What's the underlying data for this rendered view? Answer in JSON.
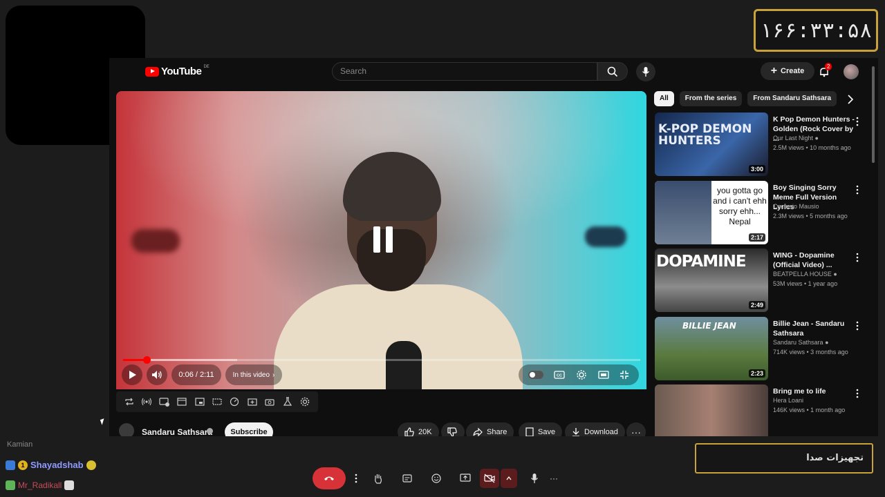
{
  "overlay": {
    "timer": "۱۶۶:۳۳:۵۸",
    "notification_text": "تجهیزات صدا"
  },
  "youtube": {
    "logo_text": "YouTube",
    "logo_country": "DE",
    "search_placeholder": "Search",
    "create_label": "Create",
    "notification_count": "2",
    "player": {
      "time": "0:06 / 2:11",
      "in_this_video": "In this video",
      "progress_fraction": 0.046,
      "state": "paused"
    },
    "channel": {
      "name": "Sandaru Sathsara",
      "subscribe_label": "Subscribe",
      "likes": "20K",
      "share_label": "Share",
      "save_label": "Save",
      "download_label": "Download"
    },
    "chips": [
      "All",
      "From the series",
      "From Sandaru Sathsara"
    ],
    "recommendations": [
      {
        "title": "K Pop Demon Hunters - Golden (Rock Cover by ...",
        "channel": "Our Last Night",
        "verified": true,
        "stats": "2.5M views • 10 months ago",
        "duration": "3:00",
        "thumb_text": "K-POP DEMON HUNTERS"
      },
      {
        "title": "Boy Singing Sorry Meme Full Version Lyrics",
        "channel": "Cactusio Mausio",
        "verified": false,
        "stats": "2.3M views • 5 months ago",
        "duration": "2:17",
        "thumb_text": "you gotta go and i can't ehh sorry ehh... Nepal"
      },
      {
        "title": "WING - Dopamine (Official Video) ...",
        "channel": "BEATPELLA HOUSE",
        "verified": true,
        "stats": "53M views • 1 year ago",
        "duration": "2:49",
        "thumb_text": "DOPAMINE"
      },
      {
        "title": "Billie Jean - Sandaru Sathsara",
        "channel": "Sandaru Sathsara",
        "verified": true,
        "stats": "714K views • 3 months ago",
        "duration": "2:23",
        "thumb_text": "BILLIE JEAN"
      },
      {
        "title": "Bring me to life",
        "channel": "Hera Loani",
        "verified": false,
        "stats": "146K views • 1 month ago",
        "duration": "",
        "thumb_text": ""
      }
    ]
  },
  "chat": {
    "cut_name": "Kamian",
    "user1": "Shayadshab",
    "user1_badge": "1",
    "user2": "Mr_Radikall"
  }
}
